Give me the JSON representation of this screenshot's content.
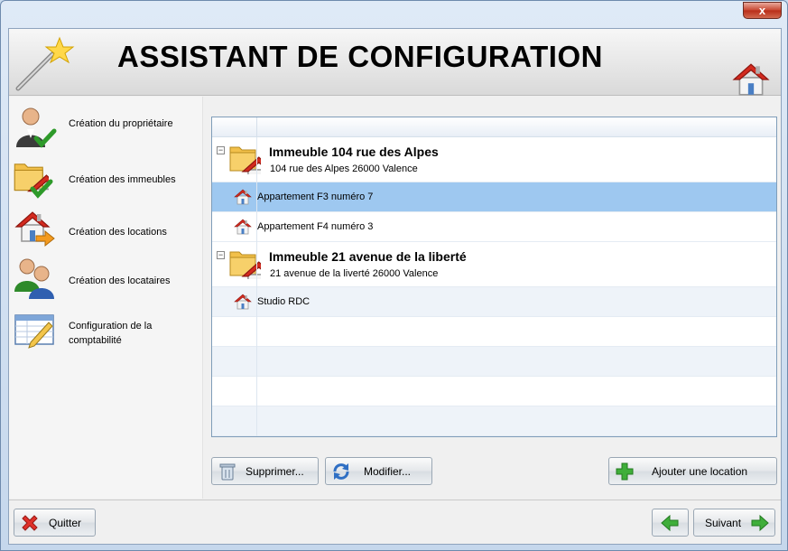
{
  "window": {
    "close_label": "x"
  },
  "header": {
    "title": "ASSISTANT DE CONFIGURATION"
  },
  "sidebar": {
    "items": [
      {
        "label": "Création du propriétaire",
        "icon": "user-check-icon"
      },
      {
        "label": "Création des immeubles",
        "icon": "folder-house-check-icon"
      },
      {
        "label": "Création des locations",
        "icon": "house-arrow-icon"
      },
      {
        "label": "Création des locataires",
        "icon": "users-icon"
      },
      {
        "label_line1": "Configuration de la",
        "label_line2": "comptabilité",
        "icon": "ledger-pencil-icon"
      }
    ]
  },
  "grid": {
    "groups": [
      {
        "title": "Immeuble 104 rue des Alpes",
        "subtitle": "104 rue des Alpes 26000 Valence",
        "toggle": "−",
        "items": [
          {
            "label": "Appartement F3 numéro 7",
            "selected": true
          },
          {
            "label": "Appartement F4 numéro 3",
            "selected": false
          }
        ]
      },
      {
        "title": "Immeuble 21 avenue de la liberté",
        "subtitle": "21 avenue de la liverté 26000 Valence",
        "toggle": "−",
        "items": [
          {
            "label": "Studio RDC",
            "selected": false
          }
        ]
      }
    ]
  },
  "actions": {
    "delete_label": "Supprimer...",
    "edit_label": "Modifier...",
    "add_label": "Ajouter une location"
  },
  "footer": {
    "quit_label": "Quitter",
    "next_label": "Suivant"
  },
  "colors": {
    "selection": "#9ec8f0",
    "accent_green": "#2e9a2a",
    "house_roof": "#d42a1f"
  }
}
